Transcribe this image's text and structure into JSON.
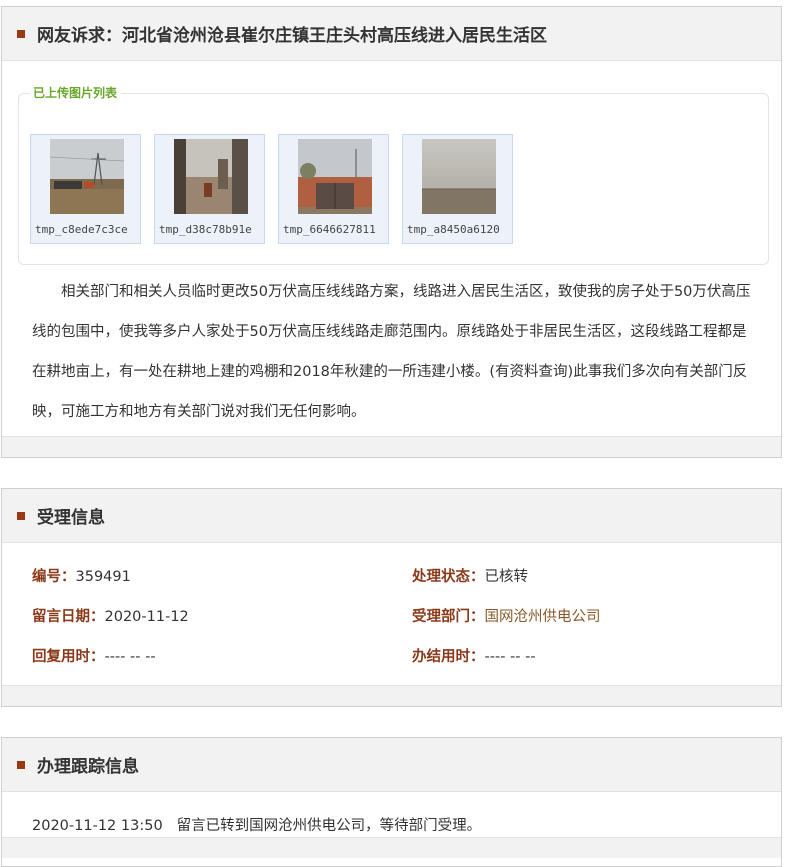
{
  "complaint": {
    "title": "网友诉求：河北省沧州沧县崔尔庄镇王庄头村高压线进入居民生活区",
    "images_legend": "已上传图片列表",
    "images": [
      {
        "caption": "tmp_c8ede7c3ce"
      },
      {
        "caption": "tmp_d38c78b91e"
      },
      {
        "caption": "tmp_6646627811"
      },
      {
        "caption": "tmp_a8450a6120"
      }
    ],
    "body": "相关部门和相关人员临时更改50万伏高压线线路方案，线路进入居民生活区，致使我的房子处于50万伏高压线的包围中，使我等多户人家处于50万伏高压线线路走廊范围内。原线路处于非居民生活区，这段线路工程都是在耕地亩上，有一处在耕地上建的鸡棚和2018年秋建的一所违建小楼。(有资料查询)此事我们多次向有关部门反映，可施工方和地方有关部门说对我们无任何影响。"
  },
  "acceptance": {
    "title": "受理信息",
    "id_label": "编号：",
    "id_value": "359491",
    "status_label": "处理状态：",
    "status_value": "已核转",
    "date_label": "留言日期：",
    "date_value": "2020-11-12",
    "dept_label": "受理部门：",
    "dept_value": "国网沧州供电公司",
    "reply_label": "回复用时：",
    "reply_value": "---- -- --",
    "finish_label": "办结用时：",
    "finish_value": "---- -- --"
  },
  "tracking": {
    "title": "办理跟踪信息",
    "entries": [
      {
        "time": "2020-11-12 13:50",
        "text": "留言已转到国网沧州供电公司，等待部门受理。"
      }
    ]
  }
}
